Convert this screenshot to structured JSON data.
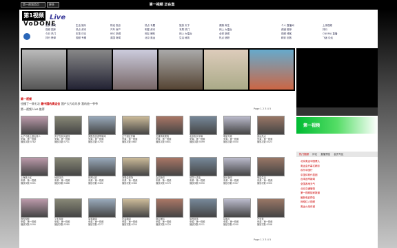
{
  "topbar": {
    "title": "第一视频 正在直",
    "home_select": "第一视频首页",
    "more_select": "更多"
  },
  "header": {
    "logo_line1": "第1视频",
    "logo_line2": "VoDONE",
    "live_text": "Live",
    "nav_columns": [
      [
        "首页 新闻",
        "视频 图库",
        "今日 热门",
        "排行 榜单"
      ],
      [
        "生活 娱乐",
        "热点 资讯",
        "军事 评论",
        "视频 专辑"
      ],
      [
        "财经 视点",
        "汽车 房产",
        "BBC 新闻",
        "英国 奇闻"
      ],
      [
        "热点 专题",
        "明星 资讯",
        "网友 爆料",
        "北京 奥运"
      ],
      [
        "旅游 天下",
        "本周 热门",
        "网上 大擂台",
        "生活 秘技"
      ],
      [
        "健康 养生",
        "网上 大擂台",
        "全球 新闻",
        "热点 追踪"
      ]
    ],
    "right_nav": [
      "个人 直播间",
      "频道 推荐",
      "视频 博客",
      "精彩 回放"
    ],
    "right_nav2": [
      "上传视频",
      "排行",
      "CNOMA 直播",
      "飞途 论坛"
    ]
  },
  "headlines": {
    "items": [
      "也撞了一周七次  ",
      "最中国的奥运会  ",
      "国产大片欢乐多  ",
      "我的爸一爷爷"
    ],
    "section_title": "第一视频",
    "grid_title": "第一视频 Live 推荐",
    "pager": "Page 1 2 3 4 5"
  },
  "video_cells": [
    [
      "女子马路上做出惊人",
      "来源：第一视频",
      "播放次数:5782"
    ],
    [
      "男子在街头被撞",
      "来源：第一视频",
      "播放次数:5731"
    ],
    [
      "美国总统选举新闻",
      "来源：第一视频",
      "播放次数:5700"
    ],
    [
      "辽宁赛区开幕",
      "来源：第一视频",
      "播放次数:5687"
    ],
    [
      "交通事故现场",
      "来源：第一视频",
      "播放次数:5601"
    ],
    [
      "北京街头车辆",
      "来源：第一视频",
      "播放次数:5599"
    ],
    [
      "明星写真",
      "来源：第一视频",
      "播放次数:5550"
    ],
    [
      "奥运热点",
      "来源：第一视频",
      "播放次数:5523"
    ],
    [
      "上海某小区",
      "来源：第一视频",
      "播放次数:5501"
    ],
    [
      "地铁站内",
      "来源：第一视频",
      "播放次数:5488"
    ],
    [
      "体育比赛",
      "来源：第一视频",
      "播放次数:5402"
    ],
    [
      "演唱会现场",
      "来源：第一视频",
      "播放次数:5380"
    ],
    [
      "会议新闻",
      "来源：第一视频",
      "播放次数:5370"
    ],
    [
      "领导人讲话",
      "来源：第一视频",
      "播放次数:5350"
    ],
    [
      "娱乐新闻",
      "来源：第一视频",
      "播放次数:5347"
    ],
    [
      "明星生活",
      "来源：第一视频",
      "播放次数:5300"
    ],
    [
      "我的视频",
      "来源：第一视频",
      "播放次数:5290"
    ],
    [
      "火车事故",
      "来源：第一视频",
      "播放次数:5280"
    ],
    [
      "军事新闻",
      "来源：第一视频",
      "播放次数:5277"
    ],
    [
      "社会新闻",
      "来源：第一视频",
      "播放次数:5250"
    ],
    [
      "网友爆料",
      "来源：第一视频",
      "播放次数:5220"
    ],
    [
      "体育赛事",
      "来源：第一视频",
      "播放次数:5211"
    ],
    [
      "动画片",
      "来源：第一视频",
      "播放次数:5200"
    ],
    [
      "汽车秀",
      "来源：第一视频",
      "播放次数:5188"
    ]
  ],
  "player": {
    "ad_text": "第一视频",
    "tabs": [
      "热门视频",
      "评论",
      "直播预告",
      "会员专区"
    ]
  },
  "hot_list": [
    "北京奥运中国健儿",
    "奥运会开幕式精彩",
    "欢乐中国行",
    "中国体育代表团",
    "台湾选举新闻",
    "全国各地天气",
    "北京交通管制",
    "第一视频独家报道",
    "最新电影预告",
    "网络红人视频",
    "奥运火炬传递"
  ],
  "colors": {
    "accent": "#cc0000",
    "brand": "#2a66b8",
    "dark": "#000000"
  }
}
